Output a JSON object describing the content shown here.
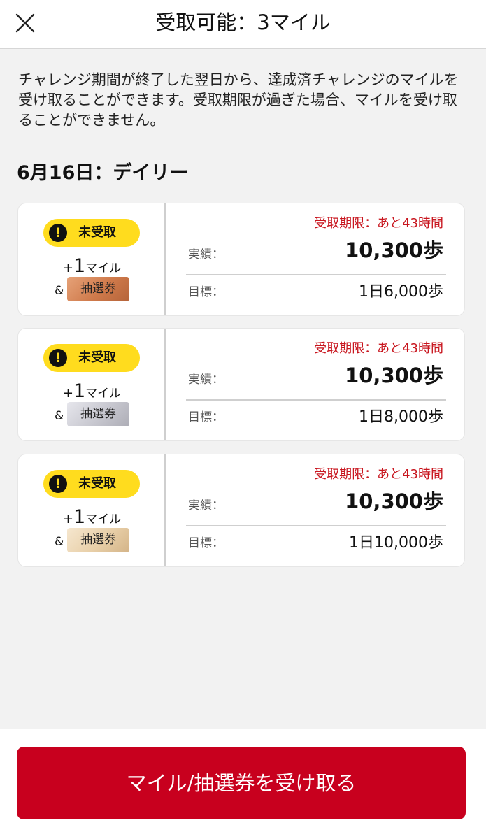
{
  "header": {
    "title": "受取可能：3マイル",
    "close_icon": "close-icon"
  },
  "description": "チャレンジ期間が終了した翌日から、達成済チャレンジのマイルを受け取ることができます。受取期限が過ぎた場合、マイルを受け取ることができません。",
  "section_title": "6月16日：デイリー",
  "cards": [
    {
      "status": "未受取",
      "plus": "+",
      "miles_num": "1",
      "miles_unit": "マイル",
      "amp": "&",
      "ticket": "抽選券",
      "deadline": "受取期限：あと43時間",
      "actual_label": "実績：",
      "actual_value": "10,300歩",
      "goal_label": "目標：",
      "goal_value": "1日6,000歩"
    },
    {
      "status": "未受取",
      "plus": "+",
      "miles_num": "1",
      "miles_unit": "マイル",
      "amp": "&",
      "ticket": "抽選券",
      "deadline": "受取期限：あと43時間",
      "actual_label": "実績：",
      "actual_value": "10,300歩",
      "goal_label": "目標：",
      "goal_value": "1日8,000歩"
    },
    {
      "status": "未受取",
      "plus": "+",
      "miles_num": "1",
      "miles_unit": "マイル",
      "amp": "&",
      "ticket": "抽選券",
      "deadline": "受取期限：あと43時間",
      "actual_label": "実績：",
      "actual_value": "10,300歩",
      "goal_label": "目標：",
      "goal_value": "1日10,000歩"
    }
  ],
  "footer": {
    "claim_label": "マイル/抽選券を受け取る"
  },
  "colors": {
    "accent_red": "#c8001e",
    "deadline_red": "#c8151e",
    "badge_yellow": "#ffdc1e",
    "ticket_bronze": "#cf7a4b",
    "ticket_silver": "#c7c7cf",
    "ticket_gold": "#e8cfa8"
  }
}
